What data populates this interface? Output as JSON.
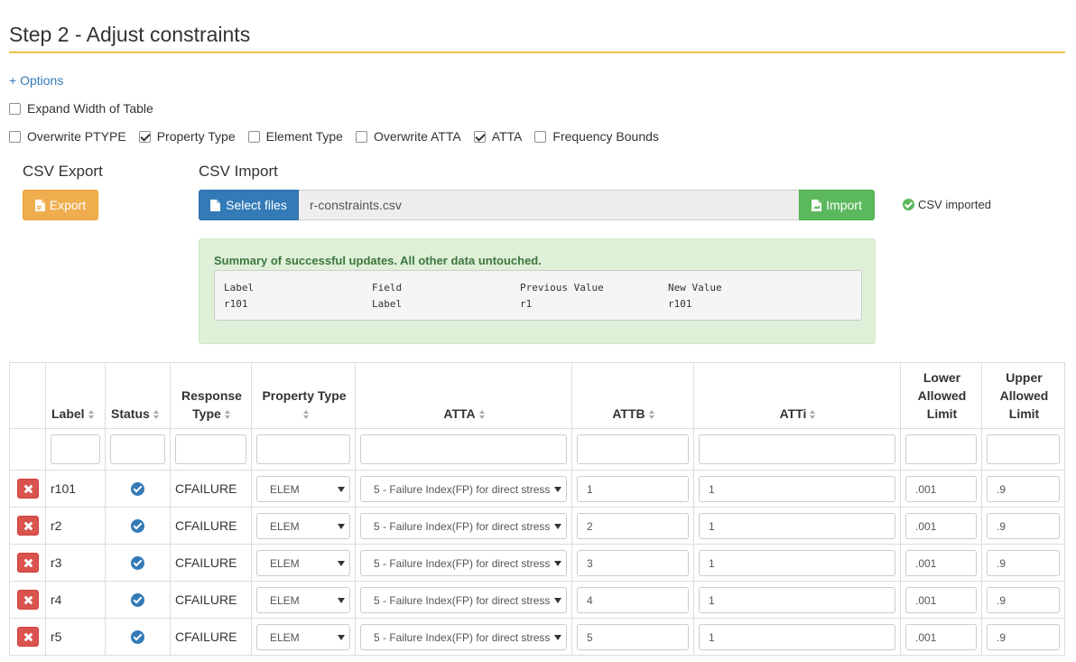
{
  "page": {
    "title": "Step 2 - Adjust constraints"
  },
  "options": {
    "link_label": "+ Options"
  },
  "checkboxes_row1": [
    {
      "label": "Expand Width of Table",
      "checked": false
    }
  ],
  "checkboxes_row2": [
    {
      "label": "Overwrite PTYPE",
      "checked": false
    },
    {
      "label": "Property Type",
      "checked": true
    },
    {
      "label": "Element Type",
      "checked": false
    },
    {
      "label": "Overwrite ATTA",
      "checked": false
    },
    {
      "label": "ATTA",
      "checked": true
    },
    {
      "label": "Frequency Bounds",
      "checked": false
    }
  ],
  "csv_export": {
    "heading": "CSV Export",
    "button_label": "Export"
  },
  "csv_import": {
    "heading": "CSV Import",
    "select_label": "Select files",
    "file_name": "r-constraints.csv",
    "import_label": "Import",
    "status_text": "CSV imported"
  },
  "summary": {
    "title": "Summary of successful updates. All other data untouched.",
    "columns": [
      "Label",
      "Field",
      "Previous Value",
      "New Value"
    ],
    "rows": [
      [
        "r101",
        "Label",
        "r1",
        "r101"
      ]
    ]
  },
  "table": {
    "headers": {
      "label": "Label",
      "status": "Status",
      "response_type": "Response Type",
      "property_type": "Property Type",
      "atta": "ATTA",
      "attb": "ATTB",
      "atti": "ATTi",
      "lower": "Lower Allowed Limit",
      "upper": "Upper Allowed Limit"
    },
    "rows": [
      {
        "label": "r101",
        "response_type": "CFAILURE",
        "property_type": "ELEM",
        "atta": "5 - Failure Index(FP) for direct stress",
        "attb": "1",
        "atti": "1",
        "lower": ".001",
        "upper": ".9"
      },
      {
        "label": "r2",
        "response_type": "CFAILURE",
        "property_type": "ELEM",
        "atta": "5 - Failure Index(FP) for direct stress",
        "attb": "2",
        "atti": "1",
        "lower": ".001",
        "upper": ".9"
      },
      {
        "label": "r3",
        "response_type": "CFAILURE",
        "property_type": "ELEM",
        "atta": "5 - Failure Index(FP) for direct stress",
        "attb": "3",
        "atti": "1",
        "lower": ".001",
        "upper": ".9"
      },
      {
        "label": "r4",
        "response_type": "CFAILURE",
        "property_type": "ELEM",
        "atta": "5 - Failure Index(FP) for direct stress",
        "attb": "4",
        "atti": "1",
        "lower": ".001",
        "upper": ".9"
      },
      {
        "label": "r5",
        "response_type": "CFAILURE",
        "property_type": "ELEM",
        "atta": "5 - Failure Index(FP) for direct stress",
        "attb": "5",
        "atti": "1",
        "lower": ".001",
        "upper": ".9"
      }
    ]
  },
  "colors": {
    "accent_rule": "#f0c24b",
    "export_button": "#f0ad4e",
    "select_button": "#337ab7",
    "import_button": "#5cb85c",
    "summary_bg": "#dff0d8",
    "delete_button": "#d9534f"
  },
  "icons": {
    "export": "file-export-icon",
    "select": "file-icon",
    "import": "file-import-icon",
    "status_ok": "check-circle-icon",
    "row_status": "check-badge-icon",
    "delete": "close-icon"
  }
}
